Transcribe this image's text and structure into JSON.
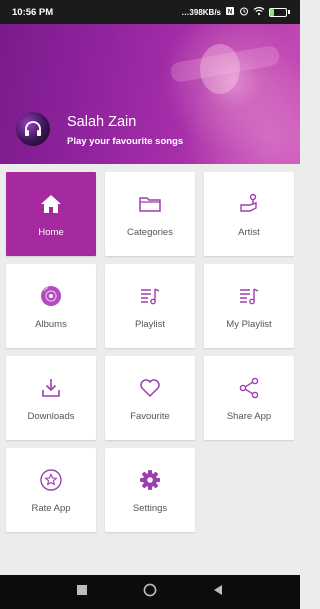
{
  "status_bar": {
    "time": "10:56 PM",
    "net_speed": "398KB/s",
    "battery_level": "26",
    "battery_fraction": 0.26,
    "icons": [
      "sim-icon",
      "alarm-icon",
      "wifi-icon",
      "battery-icon"
    ]
  },
  "header": {
    "title": "Salah Zain",
    "subtitle": "Play your favourite songs",
    "gradient_start": "#7b1a8c",
    "gradient_end": "#c84db5"
  },
  "menu": {
    "accent": "#a52a9f",
    "icon_color": "#9b3fb0",
    "items": [
      {
        "label": "Home",
        "icon": "home-icon",
        "selected": true
      },
      {
        "label": "Categories",
        "icon": "folder-icon",
        "selected": false
      },
      {
        "label": "Artist",
        "icon": "artist-icon",
        "selected": false
      },
      {
        "label": "Albums",
        "icon": "album-icon",
        "selected": false
      },
      {
        "label": "Playlist",
        "icon": "playlist-icon",
        "selected": false
      },
      {
        "label": "My Playlist",
        "icon": "my-playlist-icon",
        "selected": false
      },
      {
        "label": "Downloads",
        "icon": "download-icon",
        "selected": false
      },
      {
        "label": "Favourite",
        "icon": "heart-icon",
        "selected": false
      },
      {
        "label": "Share App",
        "icon": "share-icon",
        "selected": false
      },
      {
        "label": "Rate App",
        "icon": "star-icon",
        "selected": false
      },
      {
        "label": "Settings",
        "icon": "gear-icon",
        "selected": false
      }
    ]
  },
  "nav_bar": {
    "buttons": [
      "recent-apps-icon",
      "home-nav-icon",
      "back-icon"
    ]
  }
}
